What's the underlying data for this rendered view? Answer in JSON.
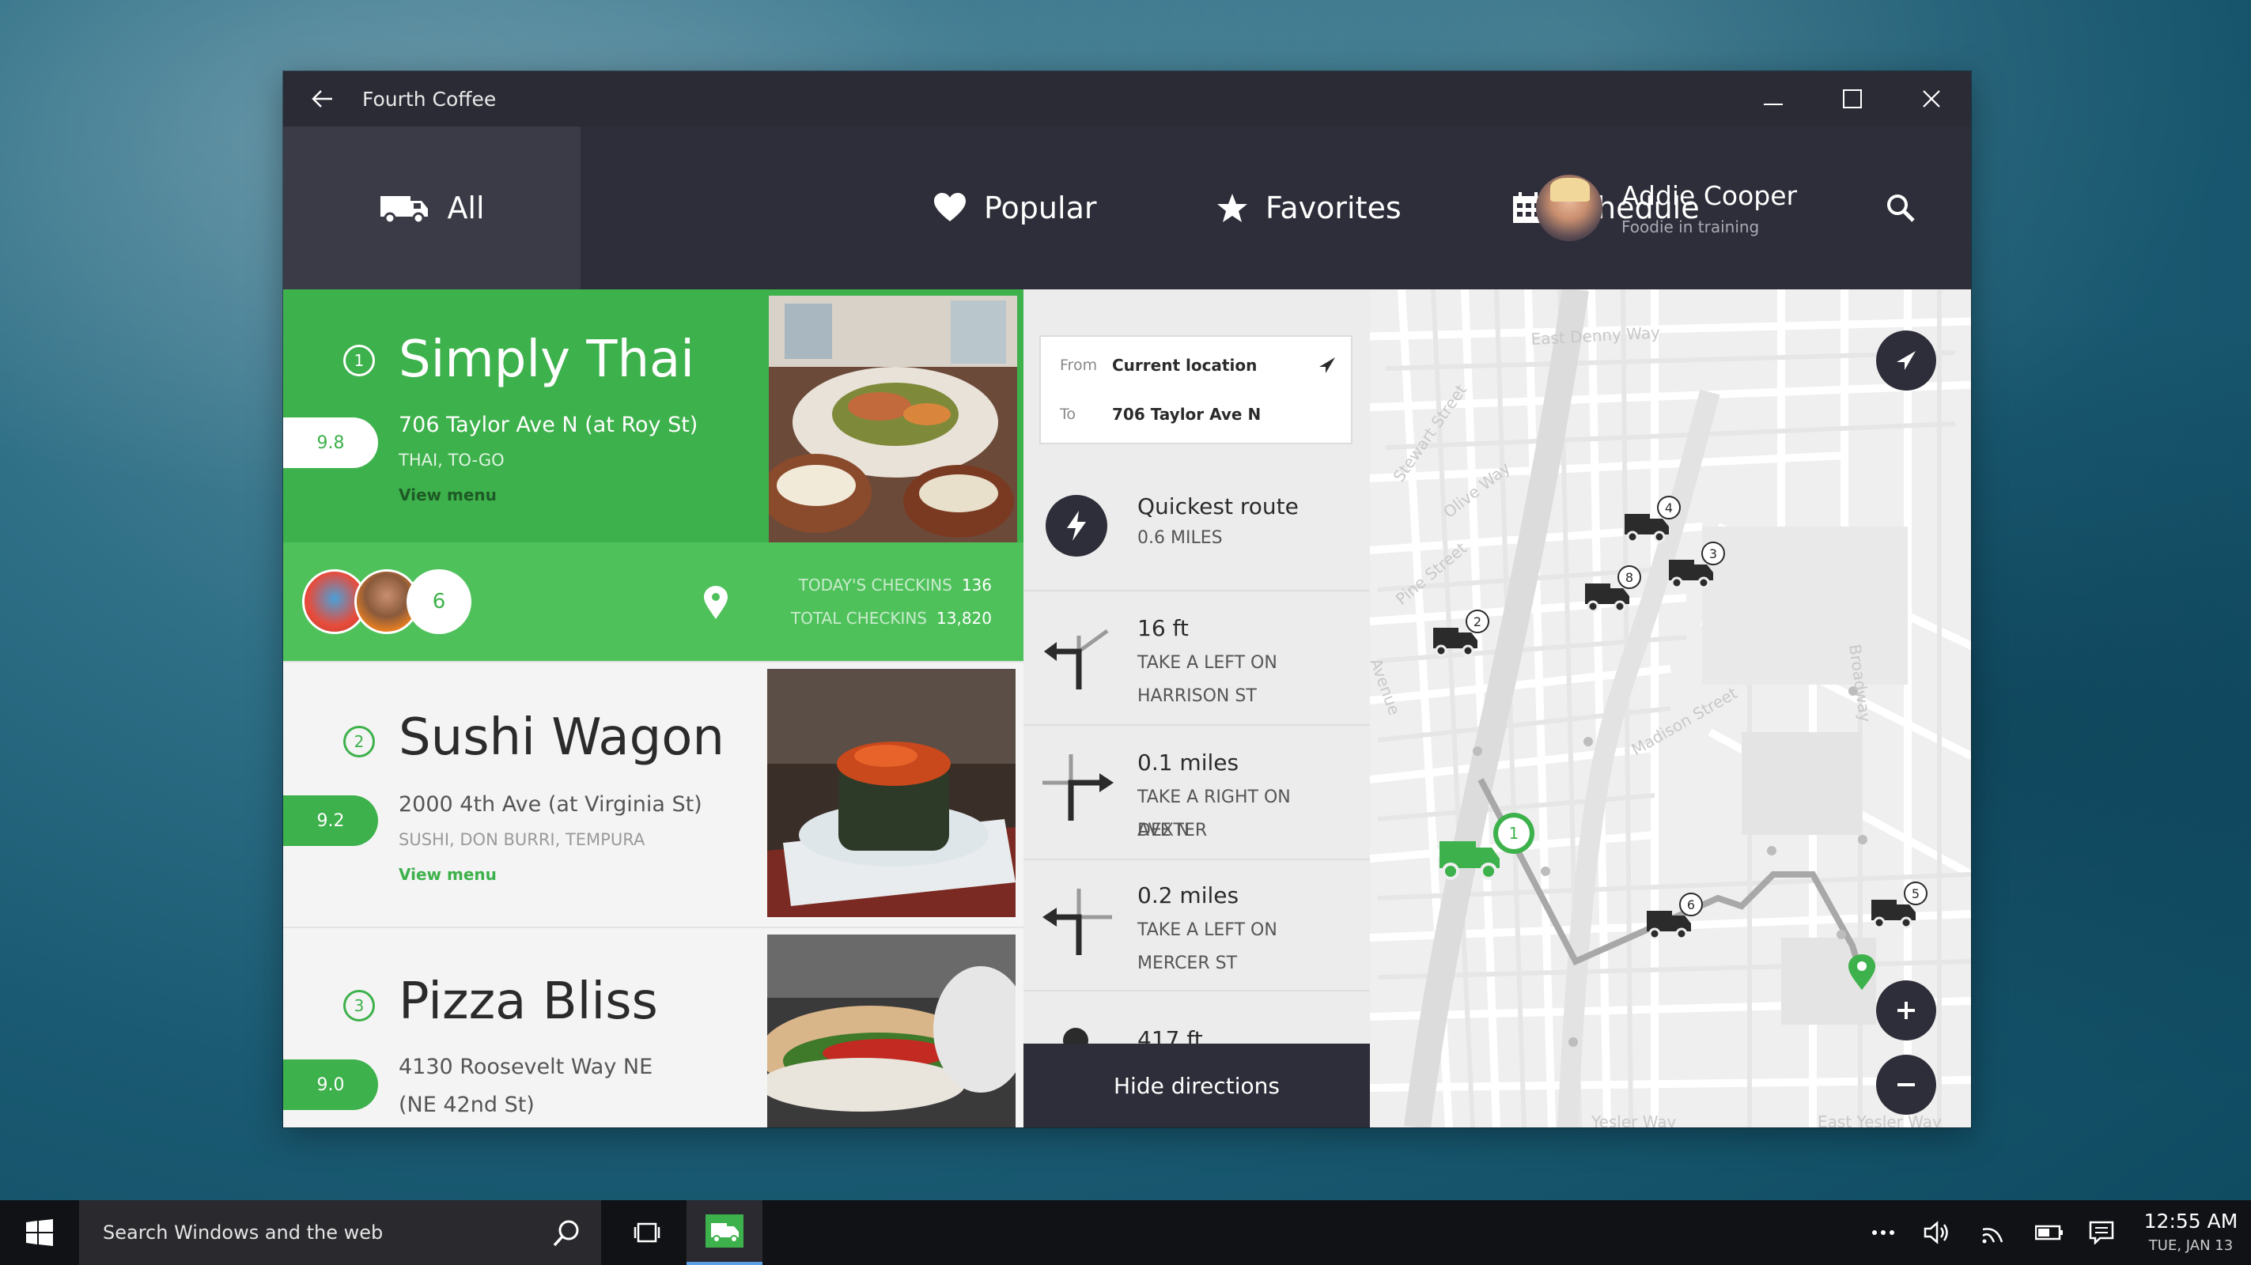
{
  "window": {
    "title": "Fourth Coffee"
  },
  "nav": {
    "tabs": [
      {
        "label": "All",
        "icon": "truck-icon"
      },
      {
        "label": "Popular",
        "icon": "heart-icon"
      },
      {
        "label": "Favorites",
        "icon": "star-icon"
      },
      {
        "label": "Schedule",
        "icon": "calendar-icon"
      }
    ],
    "profile": {
      "name": "Addie Cooper",
      "subtitle": "Foodie in training"
    }
  },
  "restaurants": [
    {
      "number": "1",
      "name": "Simply Thai",
      "rating": "9.8",
      "address": "706 Taylor Ave N (at Roy St)",
      "tags": "THAI, TO-GO",
      "menu_label": "View menu",
      "checkins": {
        "count": "6",
        "today_label": "TODAY'S CHECKINS",
        "today_value": "136",
        "total_label": "TOTAL CHECKINS",
        "total_value": "13,820"
      }
    },
    {
      "number": "2",
      "name": "Sushi Wagon",
      "rating": "9.2",
      "address": "2000 4th Ave (at Virginia St)",
      "tags": "SUSHI, DON BURRI, TEMPURA",
      "menu_label": "View menu"
    },
    {
      "number": "3",
      "name": "Pizza Bliss",
      "rating": "9.0",
      "address_line1": "4130 Roosevelt Way NE",
      "address_line2": "(NE 42nd St)"
    }
  ],
  "directions": {
    "from_label": "From",
    "from_value": "Current location",
    "to_label": "To",
    "to_value": "706 Taylor Ave N",
    "route": {
      "title": "Quickest route",
      "subtitle": "0.6 MILES"
    },
    "steps": [
      {
        "distance": "16 ft",
        "line1": "TAKE A LEFT ON",
        "line2": "HARRISON ST"
      },
      {
        "distance": "0.1 miles",
        "line1": "TAKE A RIGHT ON DEXTER",
        "line2": "AVE N"
      },
      {
        "distance": "0.2 miles",
        "line1": "TAKE A LEFT ON",
        "line2": "MERCER ST"
      },
      {
        "distance": "417 ft"
      }
    ],
    "hide_label": "Hide directions"
  },
  "map": {
    "streets": [
      "East Denny Way",
      "Stewart Street",
      "Olive Way",
      "Pine Street",
      "Madison Street",
      "Broadway",
      "Yesler Way",
      "East Yesler Way",
      "Avenue"
    ],
    "truck_badges": [
      "1",
      "2",
      "3",
      "4",
      "5",
      "6",
      "8"
    ],
    "accent": "#3db14b"
  },
  "taskbar": {
    "search_placeholder": "Search Windows and the web",
    "time": "12:55 AM",
    "date": "TUE, JAN 13"
  }
}
